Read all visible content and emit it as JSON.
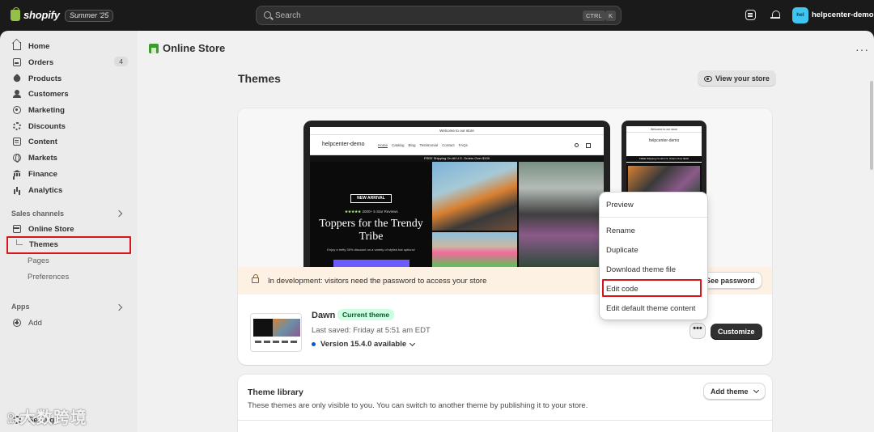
{
  "topbar": {
    "logo_text": "shopify",
    "edition": "Summer '25",
    "search_placeholder": "Search",
    "kbd_ctrl": "CTRL",
    "kbd_k": "K",
    "avatar_initials": "hel",
    "store_name": "helpcenter-demo"
  },
  "sidebar": {
    "items": [
      {
        "label": "Home",
        "icon": "home-icon"
      },
      {
        "label": "Orders",
        "icon": "orders-icon",
        "badge": "4"
      },
      {
        "label": "Products",
        "icon": "tag-icon"
      },
      {
        "label": "Customers",
        "icon": "person-icon"
      },
      {
        "label": "Marketing",
        "icon": "target-icon"
      },
      {
        "label": "Discounts",
        "icon": "discount-icon"
      },
      {
        "label": "Content",
        "icon": "document-icon"
      },
      {
        "label": "Markets",
        "icon": "globe-icon"
      },
      {
        "label": "Finance",
        "icon": "bank-icon"
      },
      {
        "label": "Analytics",
        "icon": "bar-chart-icon"
      }
    ],
    "sales_channels_label": "Sales channels",
    "online_store_label": "Online Store",
    "themes_label": "Themes",
    "pages_label": "Pages",
    "preferences_label": "Preferences",
    "apps_label": "Apps",
    "add_label": "Add",
    "settings_label": "Settings"
  },
  "page": {
    "title": "Online Store",
    "section_title": "Themes",
    "view_store_label": "View your store"
  },
  "preview": {
    "announcement": "Welcome to our store",
    "site_logo": "helpcenter-demo",
    "nav": [
      "Home",
      "Catalog",
      "Blog",
      "Testimonial",
      "Contact",
      "FAQs"
    ],
    "shipping_bar": "FREE Shipping On All U.S. Orders Over $100",
    "badge": "NEW ARRIVAL",
    "stars": "★★★★★",
    "reviews": "2000+ 5 Star Reviews",
    "headline": "Toppers for the Trendy Tribe",
    "subline": "Enjoy a hefty 30% discount on a variety of stylish hat options!",
    "phone_announcement": "Welcome to our store",
    "phone_logo": "helpcenter-demo",
    "phone_shipping": "FREE Shipping On All U.S. Orders Over $100"
  },
  "banner": {
    "text": "In development: visitors need the password to access your store",
    "button": "See password"
  },
  "theme": {
    "name": "Dawn",
    "badge": "Current theme",
    "last_saved": "Last saved: Friday at 5:51 am EDT",
    "version": "Version 15.4.0 available",
    "customize_label": "Customize",
    "more_label": "•••"
  },
  "menu": {
    "items": [
      "Preview",
      "Rename",
      "Duplicate",
      "Download theme file",
      "Edit code",
      "Edit default theme content"
    ]
  },
  "library": {
    "title": "Theme library",
    "description": "These themes are only visible to you. You can switch to another theme by publishing it to your store.",
    "add_theme_label": "Add theme"
  },
  "watermark": "大数跨境",
  "colors": {
    "highlight": "#d9151c",
    "badge_green": "#cdfee1",
    "banner_bg": "#fdf1e3",
    "version_dot": "#005bd3"
  }
}
